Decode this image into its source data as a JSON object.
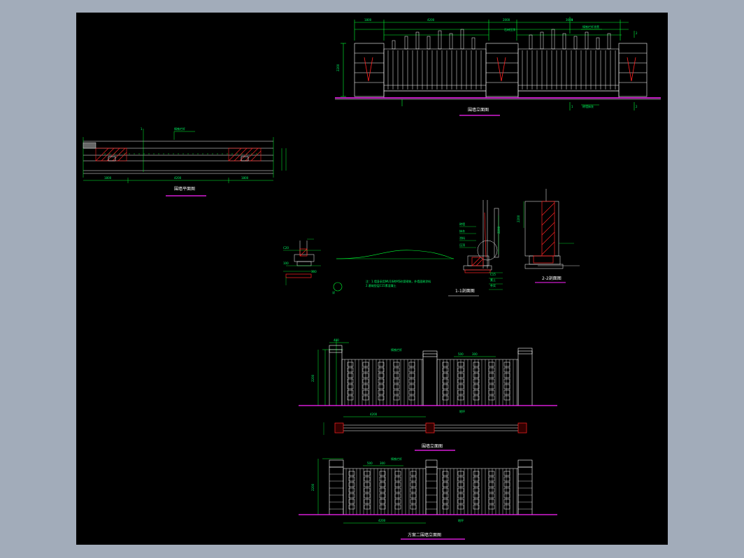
{
  "viewer": {
    "background": "#a2acba",
    "canvas_background": "#000000"
  },
  "colors": {
    "structure": "#ffffff",
    "dimension": "#00ff33",
    "hatch": "#ff2222",
    "ground": "#ff22ff",
    "marker": "#00ffff"
  },
  "drawing": {
    "views": [
      {
        "id": "elev_top",
        "title": "围墙立面图"
      },
      {
        "id": "plan",
        "title": "围墙平面图"
      },
      {
        "id": "section_a",
        "title": "1-1剖面图"
      },
      {
        "id": "section_b",
        "title": "2-2剖面图"
      },
      {
        "id": "elev_mid",
        "title": "围墙立面图"
      },
      {
        "id": "elev_bottom",
        "title": "方案二围墙立面图"
      }
    ]
  }
}
